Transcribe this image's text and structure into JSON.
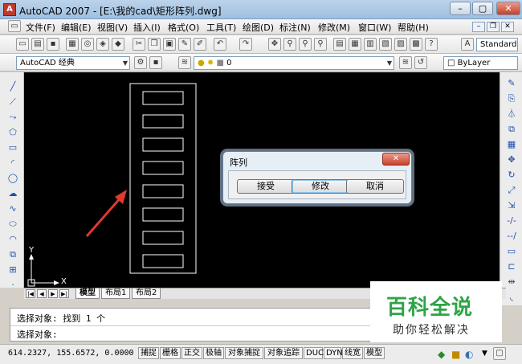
{
  "window": {
    "title": "AutoCAD 2007 - [E:\\我的cad\\矩形阵列.dwg]",
    "app_icon": "A",
    "min": "–",
    "max": "▢",
    "close": "✕"
  },
  "menu": {
    "items": [
      "文件(F)",
      "编辑(E)",
      "视图(V)",
      "插入(I)",
      "格式(O)",
      "工具(T)",
      "绘图(D)",
      "标注(N)",
      "修改(M)",
      "窗口(W)",
      "帮助(H)"
    ],
    "mdi": {
      "min": "–",
      "restore": "❐",
      "close": "✕"
    }
  },
  "toolbar": {
    "text_style": "Standard",
    "workspace": "AutoCAD 经典",
    "layer": "0",
    "linetype": "ByLayer"
  },
  "left_tools": [
    "line-icon",
    "xline-icon",
    "pline-icon",
    "polygon-icon",
    "rectangle-icon",
    "arc-icon",
    "circle-icon",
    "revcloud-icon",
    "spline-icon",
    "ellipse-icon",
    "ellipse-arc-icon",
    "insert-block-icon",
    "make-block-icon",
    "point-icon",
    "hatch-icon"
  ],
  "right_tools": [
    "erase-icon",
    "copy-icon",
    "mirror-icon",
    "offset-icon",
    "array-icon",
    "move-icon",
    "rotate-icon",
    "scale-icon",
    "stretch-icon",
    "trim-icon",
    "extend-icon",
    "break-icon",
    "join-icon",
    "chamfer-icon",
    "fillet-icon"
  ],
  "canvas": {
    "rect_count": 8,
    "ucs": {
      "x_label": "X",
      "y_label": "Y"
    }
  },
  "tabs": {
    "nav": [
      "|◀",
      "◀",
      "▶",
      "▶|"
    ],
    "items": [
      "模型",
      "布局1",
      "布局2"
    ]
  },
  "command": {
    "history": "选择对象: 找到 1 个",
    "prompt": "选择对象:"
  },
  "status": {
    "coords": "614.2327,  155.6572, 0.0000",
    "buttons": [
      "捕捉",
      "栅格",
      "正交",
      "极轴",
      "对象捕捉",
      "对象追踪",
      "DUCS",
      "DYN",
      "线宽",
      "模型"
    ]
  },
  "dialog": {
    "title": "阵列",
    "close": "✕",
    "buttons": {
      "accept": "接受",
      "modify": "修改",
      "cancel": "取消"
    }
  },
  "watermark": {
    "main": "百科全说",
    "sub": "助你轻松解决"
  },
  "colors": {
    "canvas": "#000000",
    "accent": "#e03a2f",
    "watermark_green": "#2ea446"
  }
}
